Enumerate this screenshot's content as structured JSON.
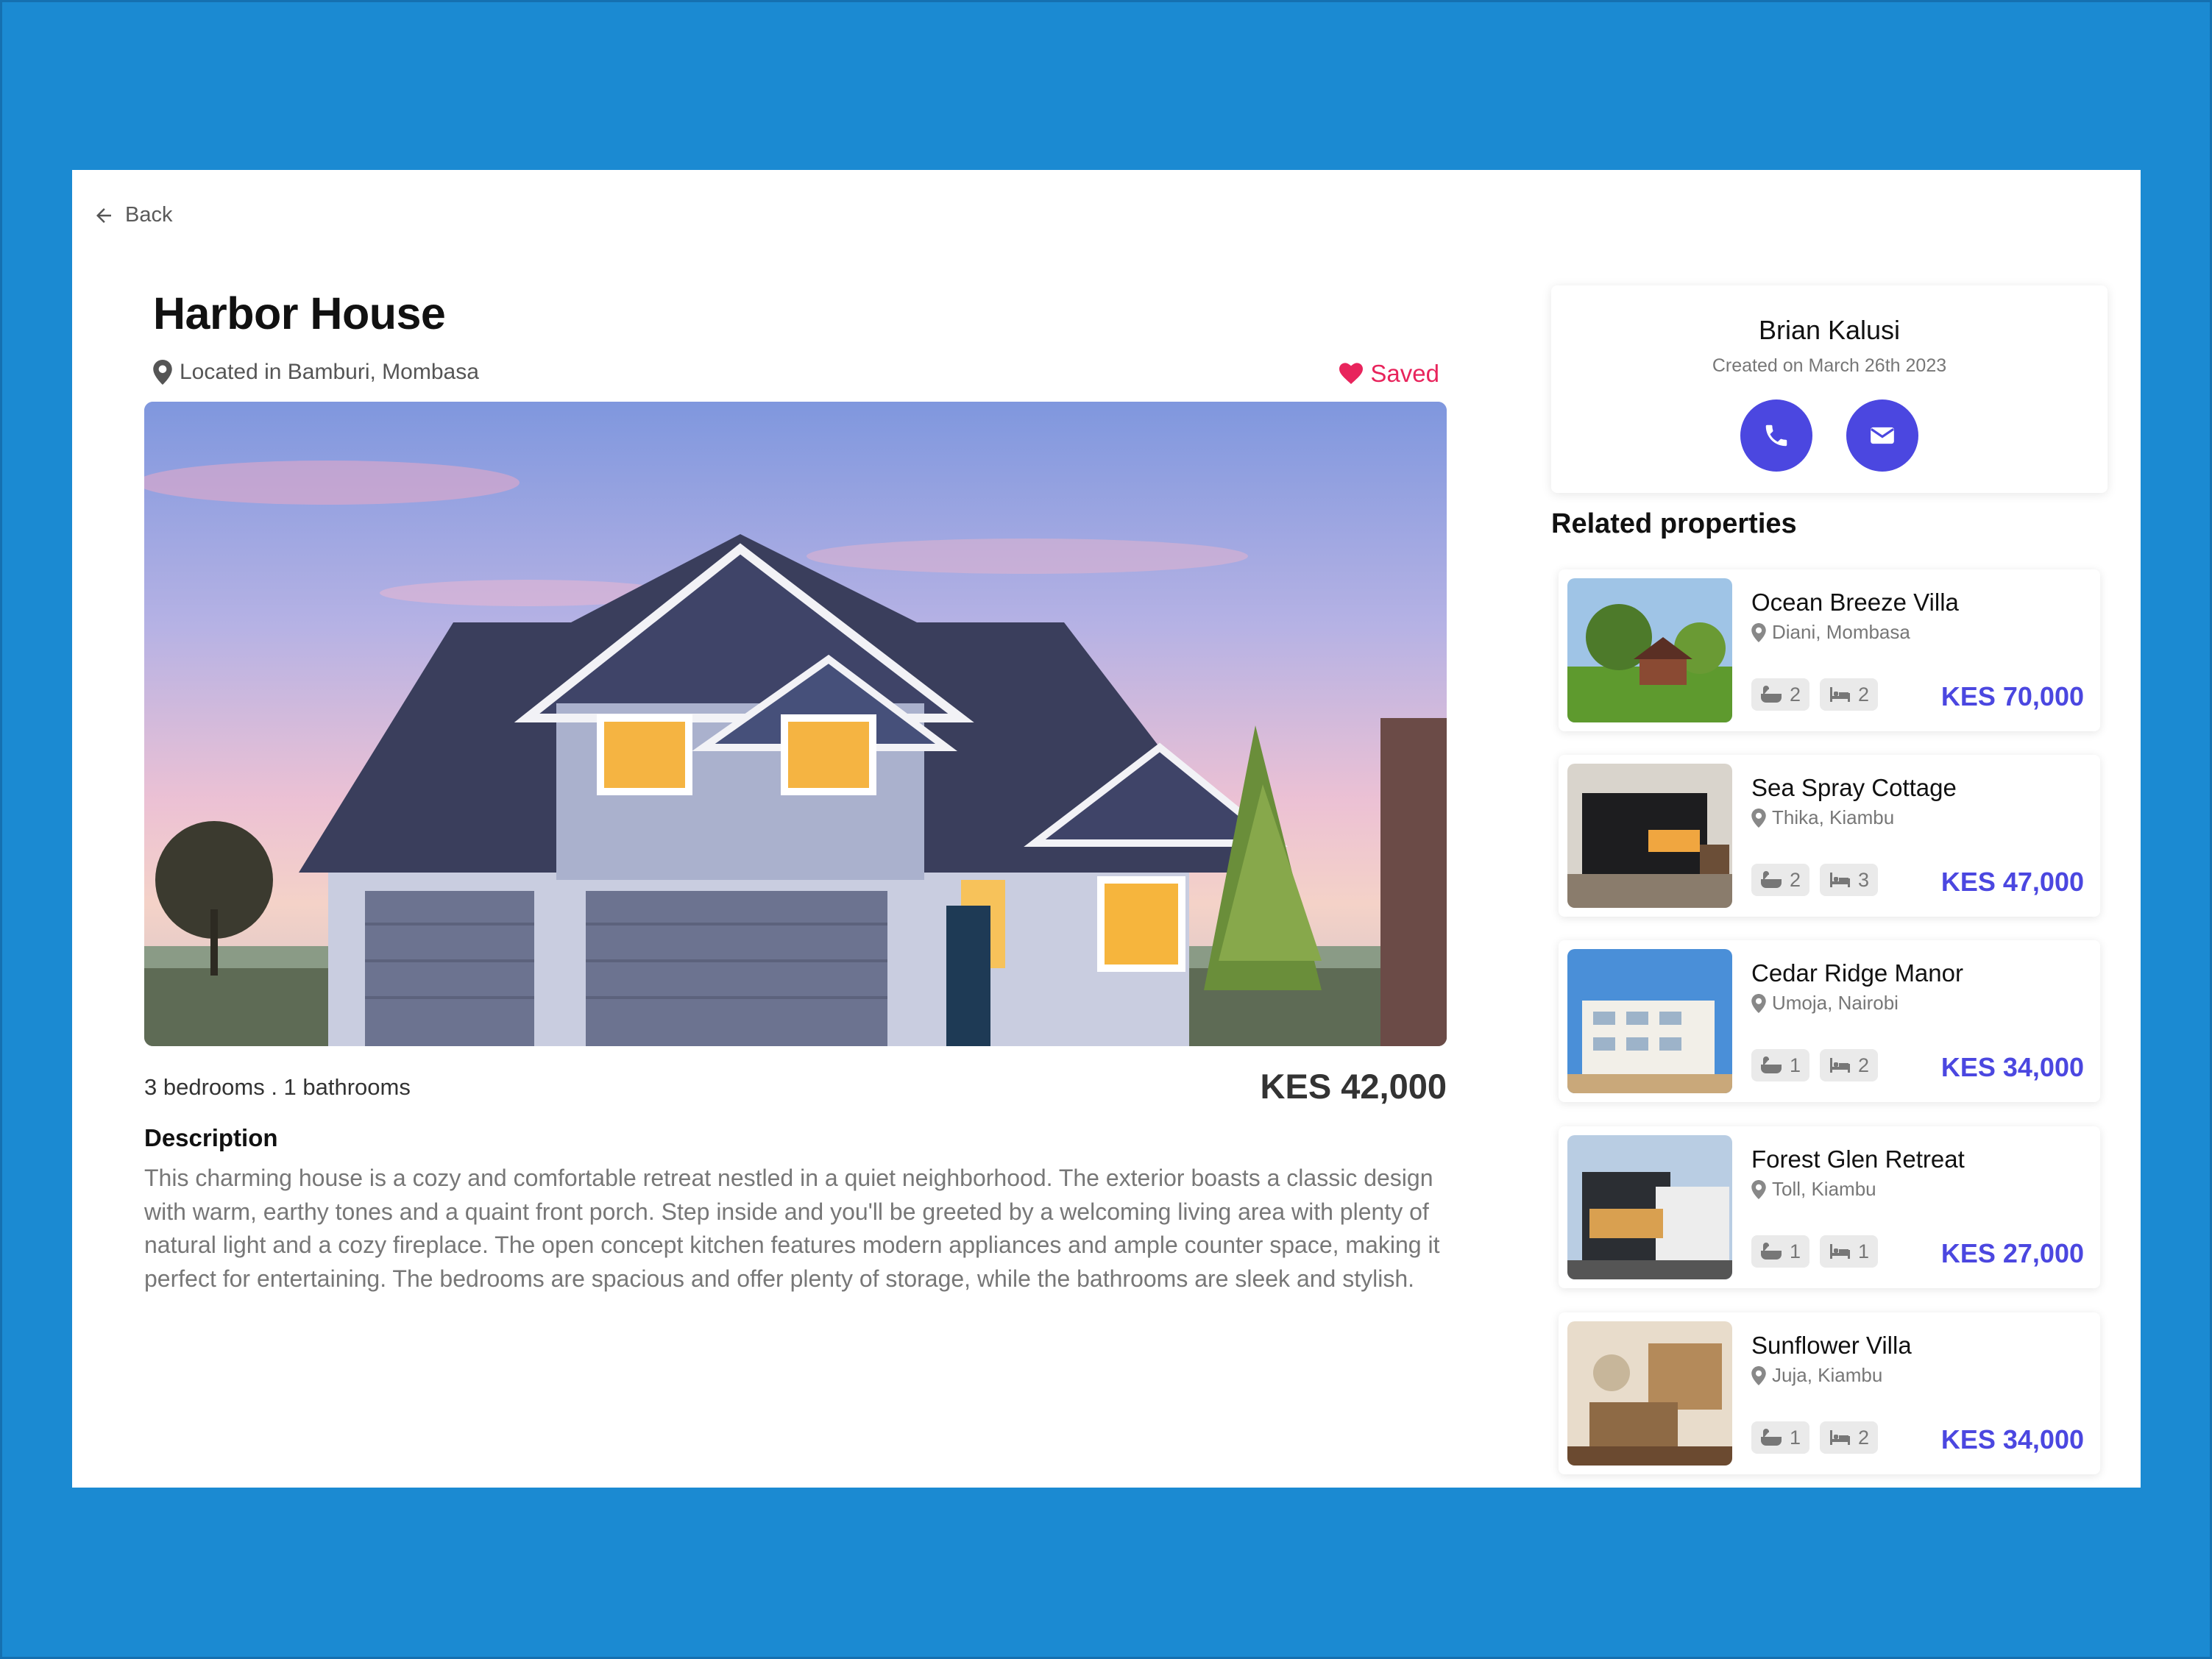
{
  "back_label": "Back",
  "property": {
    "title": "Harbor House",
    "location": "Located in Bamburi, Mombasa",
    "saved_label": "Saved",
    "meta": "3 bedrooms . 1 bathrooms",
    "price": "KES 42,000",
    "description_heading": "Description",
    "description": "This charming house is a cozy and comfortable retreat nestled in a quiet neighborhood. The exterior boasts a classic design with warm, earthy tones and a quaint front porch. Step inside and you'll be greeted by a welcoming living area with plenty of natural light and a cozy fireplace. The open concept kitchen features modern appliances and ample counter space, making it perfect for entertaining. The bedrooms are spacious and offer plenty of storage, while the bathrooms are sleek and stylish."
  },
  "agent": {
    "name": "Brian Kalusi",
    "created": "Created on March 26th 2023",
    "buttons": [
      "phone-icon",
      "envelope-icon"
    ]
  },
  "related_heading": "Related properties",
  "related": [
    {
      "name": "Ocean Breeze Villa",
      "location": "Diani, Mombasa",
      "baths": "2",
      "beds": "2",
      "price": "KES 70,000"
    },
    {
      "name": "Sea Spray Cottage",
      "location": "Thika, Kiambu",
      "baths": "2",
      "beds": "3",
      "price": "KES 47,000"
    },
    {
      "name": "Cedar Ridge Manor",
      "location": "Umoja, Nairobi",
      "baths": "1",
      "beds": "2",
      "price": "KES 34,000"
    },
    {
      "name": "Forest Glen Retreat",
      "location": "Toll, Kiambu",
      "baths": "1",
      "beds": "1",
      "price": "KES 27,000"
    },
    {
      "name": "Sunflower Villa",
      "location": "Juja, Kiambu",
      "baths": "1",
      "beds": "2",
      "price": "KES 34,000"
    }
  ],
  "colors": {
    "background": "#1b8ad2",
    "accent": "#4b47e0",
    "saved": "#e8245c"
  }
}
